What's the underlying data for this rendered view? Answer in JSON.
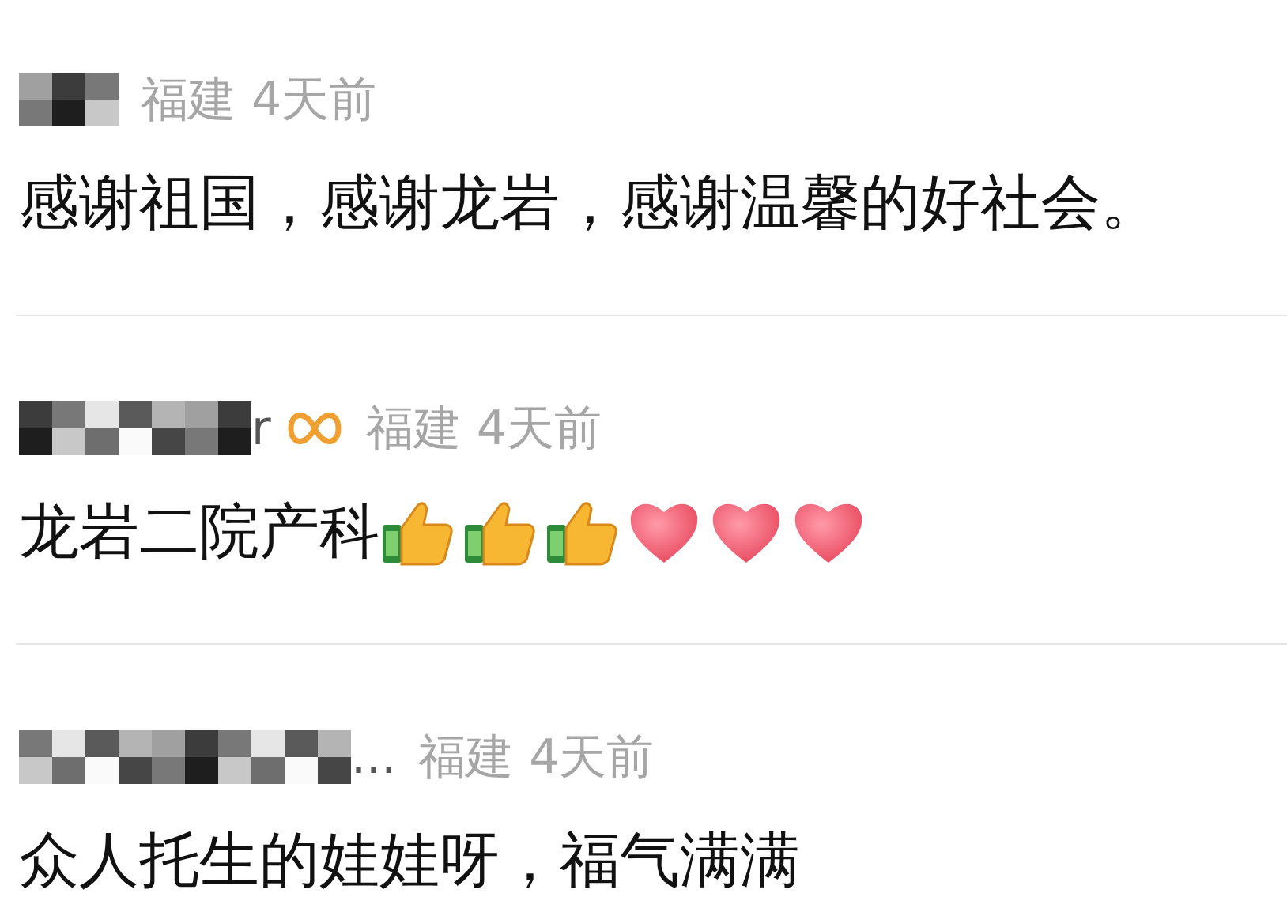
{
  "comments": [
    {
      "vip_badge": false,
      "location": "福建",
      "time": "4天前",
      "text": "感谢祖国，感谢龙岩，感谢温馨的好社会。"
    },
    {
      "name_tail": "r",
      "vip_badge": true,
      "location": "福建",
      "time": "4天前",
      "text": "龙岩二院产科",
      "emojis": [
        {
          "kind": "thumbs_up"
        },
        {
          "kind": "thumbs_up"
        },
        {
          "kind": "thumbs_up"
        },
        {
          "kind": "heart"
        },
        {
          "kind": "heart"
        },
        {
          "kind": "heart"
        }
      ]
    },
    {
      "name_tail": "...",
      "vip_badge": false,
      "location": "福建",
      "time": "4天前",
      "text": "众人托生的娃娃呀，福气满满"
    }
  ]
}
